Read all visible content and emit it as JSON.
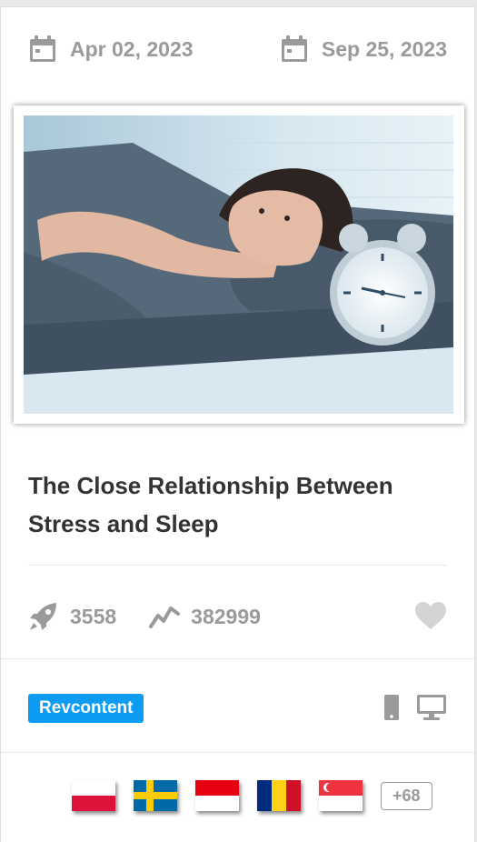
{
  "dates": {
    "start": "Apr 02, 2023",
    "end": "Sep 25, 2023"
  },
  "image": {
    "alt": "Woman lying awake in bed next to an alarm clock"
  },
  "title": "The Close Relationship Between Stress and Sleep",
  "stats": {
    "launches": "3558",
    "impressions": "382999"
  },
  "network": {
    "label": "Revcontent",
    "color": "#0e9bf2"
  },
  "devices": [
    "mobile-icon",
    "desktop-icon"
  ],
  "countries": [
    "Poland",
    "Sweden",
    "Indonesia",
    "Romania",
    "Singapore"
  ],
  "more_countries": "+68",
  "colors": {
    "muted": "#9a9a9a",
    "title": "#333333"
  }
}
